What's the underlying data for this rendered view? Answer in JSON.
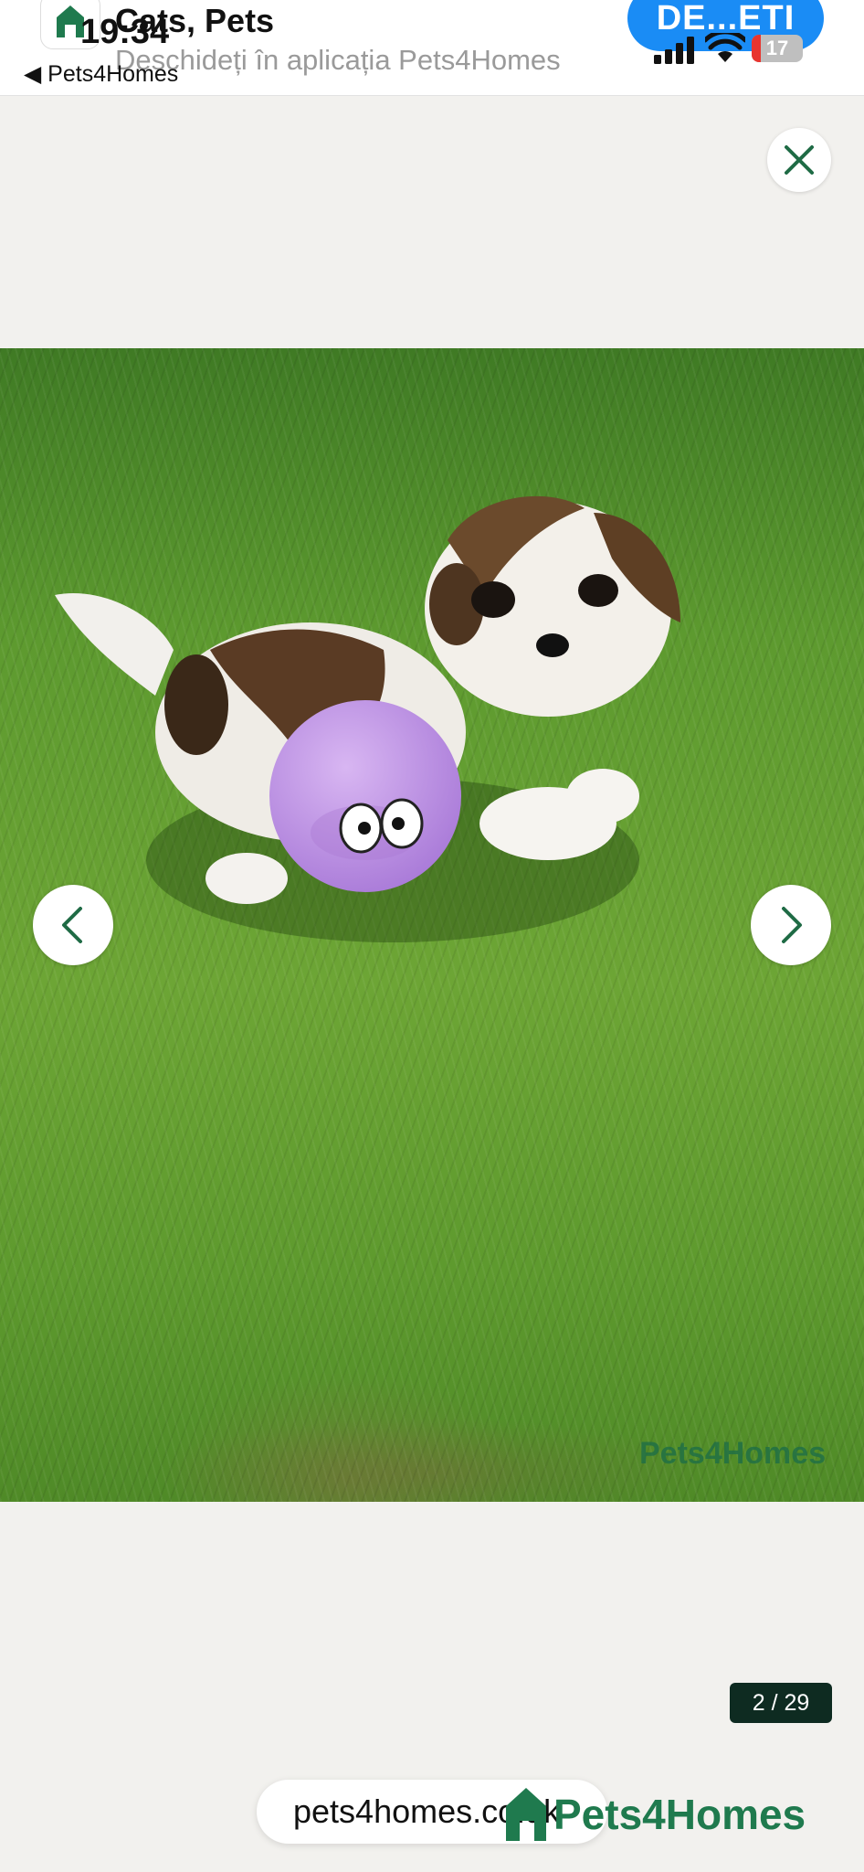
{
  "status_bar": {
    "time": "19:34",
    "battery": "17",
    "back_app": "◀ Pets4Homes"
  },
  "smart_banner": {
    "title": "Cats, Pets",
    "subtitle": "Deschideți în aplicația Pets4Homes",
    "open_button": "DE...ETI"
  },
  "gallery": {
    "image_alt": "Shih Tzu puppy with purple toy on grass",
    "watermark": "Pets4Homes",
    "counter": "2 / 29",
    "icons": {
      "close": "close-icon",
      "prev": "chevron-left-icon",
      "next": "chevron-right-icon"
    }
  },
  "browser": {
    "url": "pets4homes.co.uk"
  },
  "brand": {
    "name": "Pets4Homes",
    "color": "#1f7a4e"
  },
  "colors": {
    "open_button": "#1a8cf5",
    "counter_bg": "#0e2b21",
    "page_bg": "#f2f1ee"
  }
}
